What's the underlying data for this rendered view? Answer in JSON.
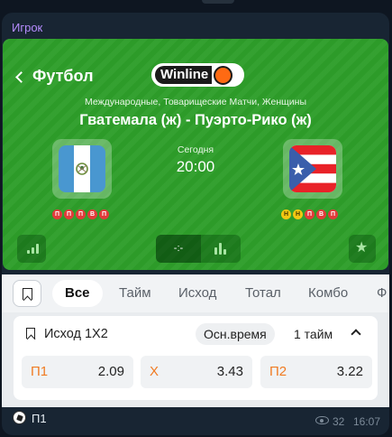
{
  "message": {
    "sender": "Игрок",
    "caption": "П1",
    "views": "32",
    "time": "16:07"
  },
  "card": {
    "back_label": "Футбол",
    "brand": "Winline",
    "league": "Международные, Товарищеские Матчи, Женщины",
    "match": "Гватемала (ж) - Пуэрто-Рико (ж)",
    "date": "Сегодня",
    "time": "20:00",
    "score": "-:-",
    "home_form": [
      "П",
      "П",
      "П",
      "В",
      "П"
    ],
    "away_form": [
      "Н",
      "Н",
      "П",
      "В",
      "П"
    ],
    "colors": {
      "card_green": "#2e9e2a",
      "loss": "#e23b3b",
      "draw": "#f3c712"
    }
  },
  "tabs": [
    {
      "label": "Все",
      "active": true
    },
    {
      "label": "Тайм"
    },
    {
      "label": "Исход"
    },
    {
      "label": "Тотал"
    },
    {
      "label": "Комбо"
    },
    {
      "label": "Ф"
    }
  ],
  "market": {
    "title": "Исход 1X2",
    "period_active": "Осн.время",
    "period_other": "1 тайм",
    "odds": [
      {
        "label": "П1",
        "value": "2.09"
      },
      {
        "label": "Х",
        "value": "3.43"
      },
      {
        "label": "П2",
        "value": "3.22"
      }
    ]
  }
}
